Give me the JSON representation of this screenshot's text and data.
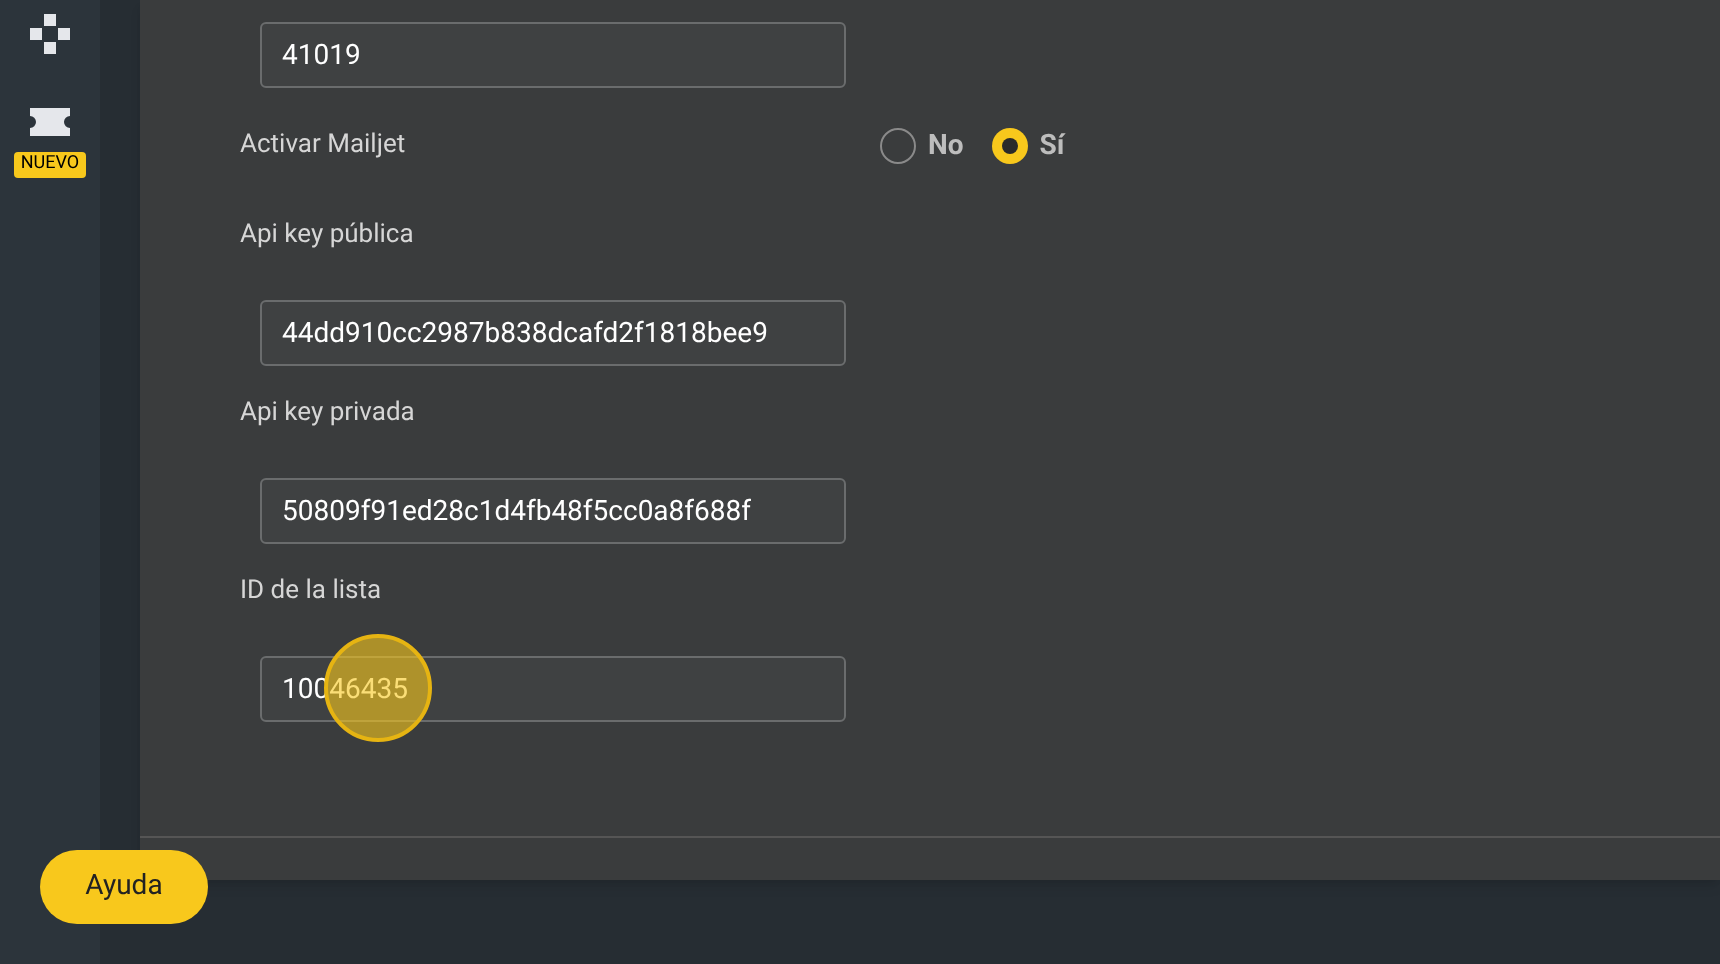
{
  "sidebar": {
    "items": [
      {
        "kind": "gamepad"
      },
      {
        "kind": "ticket",
        "badge": "NUEVO"
      }
    ]
  },
  "form": [
    {
      "kind": "input",
      "value": "41019"
    },
    {
      "kind": "radio",
      "label": "Activar Mailjet",
      "options": [
        {
          "label": "No",
          "selected": false
        },
        {
          "label": "Sí",
          "selected": true
        }
      ]
    },
    {
      "kind": "input",
      "label": "Api key pública",
      "value": "44dd910cc2987b838dcafd2f1818bee9"
    },
    {
      "kind": "input",
      "label": "Api key privada",
      "value": "50809f91ed28c1d4fb48f5cc0a8f688f"
    },
    {
      "kind": "input",
      "label": "ID de la lista",
      "value": "10046435",
      "click_marker": true
    }
  ],
  "help_button": "Ayuda"
}
